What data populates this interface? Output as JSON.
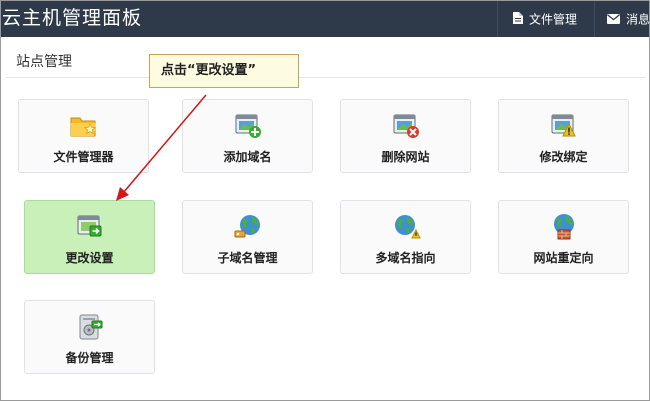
{
  "header": {
    "title": "云主机管理面板",
    "file_manager": "文件管理",
    "messages": "消息"
  },
  "section": {
    "title": "站点管理"
  },
  "callout": {
    "text": "点击“更改设置”"
  },
  "tiles": [
    {
      "label": "文件管理器",
      "icon": "folder-star-icon"
    },
    {
      "label": "添加域名",
      "icon": "add-domain-icon"
    },
    {
      "label": "删除网站",
      "icon": "delete-site-icon"
    },
    {
      "label": "修改绑定",
      "icon": "modify-binding-icon"
    },
    {
      "label": "更改设置",
      "icon": "change-settings-icon"
    },
    {
      "label": "子域名管理",
      "icon": "subdomain-globe-icon"
    },
    {
      "label": "多域名指向",
      "icon": "multi-domain-globe-icon"
    },
    {
      "label": "网站重定向",
      "icon": "redirect-globe-icon"
    },
    {
      "label": "备份管理",
      "icon": "backup-disk-icon"
    }
  ],
  "colors": {
    "header_bg": "#2e3a49",
    "active_tile_bg": "#c8f0b8",
    "callout_bg": "#fdfbe0",
    "arrow": "#d01818"
  }
}
